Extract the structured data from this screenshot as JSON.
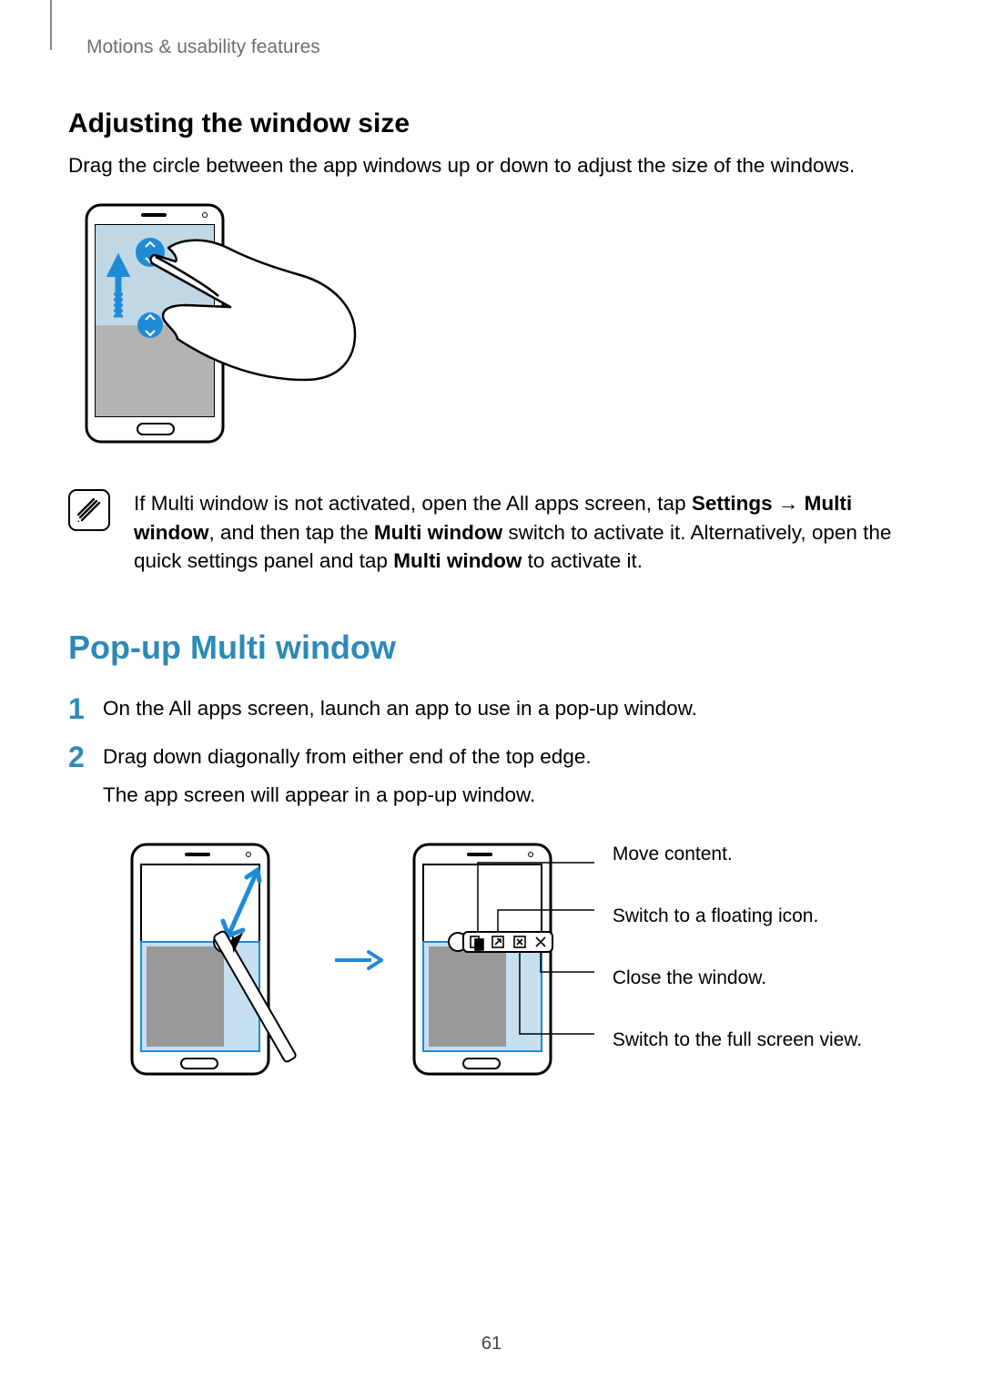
{
  "header": "Motions & usability features",
  "section1": {
    "title": "Adjusting the window size",
    "body": "Drag the circle between the app windows up or down to adjust the size of the windows."
  },
  "note": {
    "pre": "If Multi window is not activated, open the All apps screen, tap ",
    "settings": "Settings",
    "arrow": " → ",
    "mw1": "Multi window",
    "mid1": ", and then tap the ",
    "mw2": "Multi window",
    "mid2": " switch to activate it. Alternatively, open the quick settings panel and tap ",
    "mw3": "Multi window",
    "post": " to activate it."
  },
  "section2": {
    "title": "Pop-up Multi window",
    "steps": [
      "On the All apps screen, launch an app to use in a pop-up window.",
      "Drag down diagonally from either end of the top edge."
    ],
    "step2_extra": "The app screen will appear in a pop-up window."
  },
  "labels": {
    "move": "Move content.",
    "float": "Switch to a floating icon.",
    "close": "Close the window.",
    "full": "Switch to the full screen view."
  },
  "page_number": "61"
}
